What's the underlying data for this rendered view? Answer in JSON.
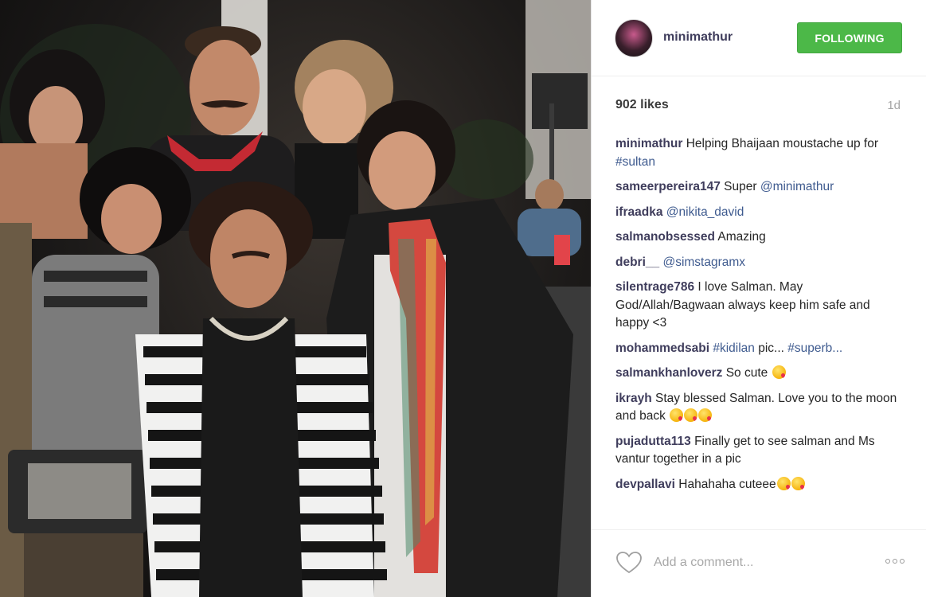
{
  "post": {
    "username": "minimathur",
    "follow_label": "FOLLOWING",
    "likes": "902 likes",
    "time": "1d",
    "colors": {
      "follow_green": "#4cb848",
      "username": "#3f3d5c",
      "link": "#3f5b8f"
    }
  },
  "comments": [
    {
      "user": "minimathur",
      "segments": [
        {
          "text": "Helping Bhaijaan moustache up for "
        },
        {
          "link": "#sultan"
        }
      ],
      "emojis": 0
    },
    {
      "user": "sameerpereira147",
      "segments": [
        {
          "text": "Super "
        },
        {
          "link": "@minimathur"
        }
      ],
      "emojis": 0
    },
    {
      "user": "ifraadka",
      "segments": [
        {
          "link": "@nikita_david"
        }
      ],
      "emojis": 0
    },
    {
      "user": "salmanobsessed",
      "segments": [
        {
          "text": "Amazing"
        }
      ],
      "emojis": 0
    },
    {
      "user": "debri__",
      "segments": [
        {
          "link": "@simstagramx"
        }
      ],
      "emojis": 0
    },
    {
      "user": "silentrage786",
      "segments": [
        {
          "text": "I love Salman. May God/Allah/Bagwaan always keep him safe and happy <3"
        }
      ],
      "emojis": 0
    },
    {
      "user": "mohammedsabi",
      "segments": [
        {
          "link": "#kidilan"
        },
        {
          "text": " pic... "
        },
        {
          "link": "#superb..."
        }
      ],
      "emojis": 0
    },
    {
      "user": "salmankhanloverz",
      "segments": [
        {
          "text": "So cute "
        }
      ],
      "emojis": 1
    },
    {
      "user": "ikrayh",
      "segments": [
        {
          "text": "Stay blessed Salman. Love you to the moon and back "
        }
      ],
      "emojis": 3
    },
    {
      "user": "pujadutta113",
      "segments": [
        {
          "text": "Finally get to see salman and Ms vantur together in a pic"
        }
      ],
      "emojis": 0
    },
    {
      "user": "devpallavi",
      "segments": [
        {
          "text": "Hahahaha cuteee"
        }
      ],
      "emojis": 2
    }
  ],
  "footer": {
    "comment_placeholder": "Add a comment...",
    "icons": [
      "heart-icon",
      "more-options-icon"
    ]
  }
}
